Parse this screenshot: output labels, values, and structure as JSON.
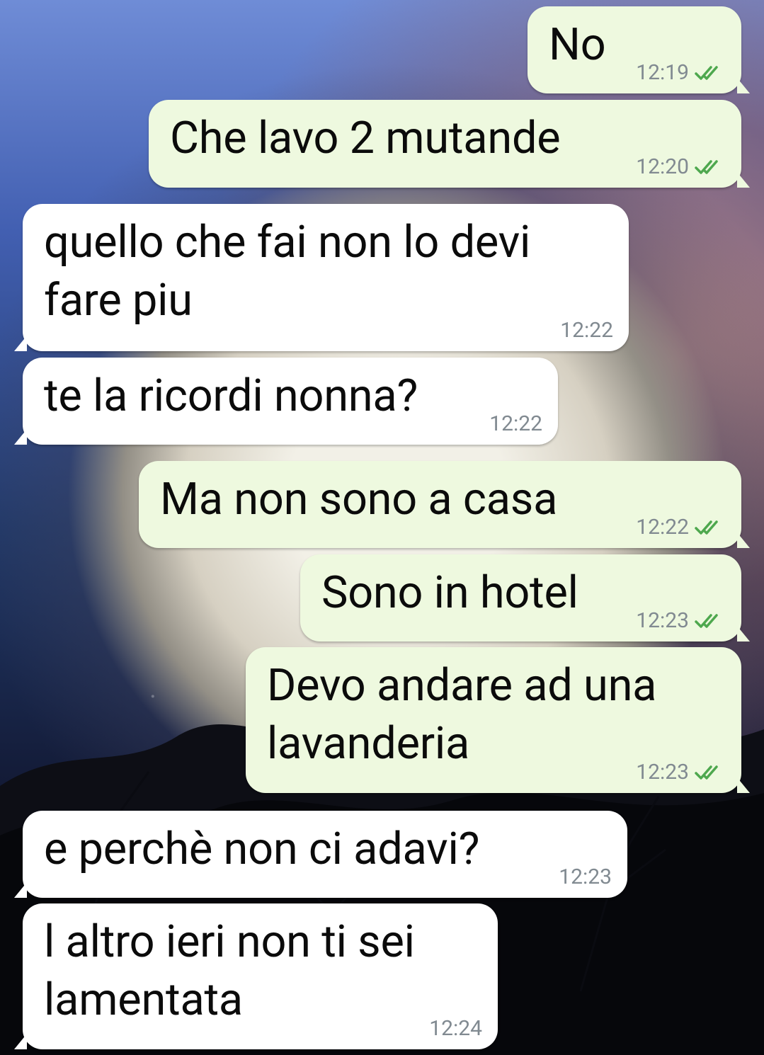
{
  "chat": {
    "messages": [
      {
        "sender": "me",
        "text": "No",
        "time": "12:19",
        "status": "read"
      },
      {
        "sender": "me",
        "text": "Che lavo 2 mutande",
        "time": "12:20",
        "status": "read"
      },
      {
        "sender": "other",
        "text": "quello che fai non lo devi\nfare piu",
        "time": "12:22"
      },
      {
        "sender": "other",
        "text": "te la ricordi nonna?",
        "time": "12:22"
      },
      {
        "sender": "me",
        "text": "Ma non sono a casa",
        "time": "12:22",
        "status": "read"
      },
      {
        "sender": "me",
        "text": "Sono in hotel",
        "time": "12:23",
        "status": "read"
      },
      {
        "sender": "me",
        "text": "Devo andare ad una\nlavanderia",
        "time": "12:23",
        "status": "read"
      },
      {
        "sender": "other",
        "text": "e perchè non ci adavi?",
        "time": "12:23"
      },
      {
        "sender": "other",
        "text": "l altro ieri non ti sei\nlamentata",
        "time": "12:24"
      }
    ]
  },
  "theme": {
    "sent_bubble": "#eef9df",
    "received_bubble": "#ffffff",
    "timestamp": "#818a91",
    "read_tick": "#4ea84e"
  },
  "icons": {
    "read_receipt": "double-check-icon"
  }
}
